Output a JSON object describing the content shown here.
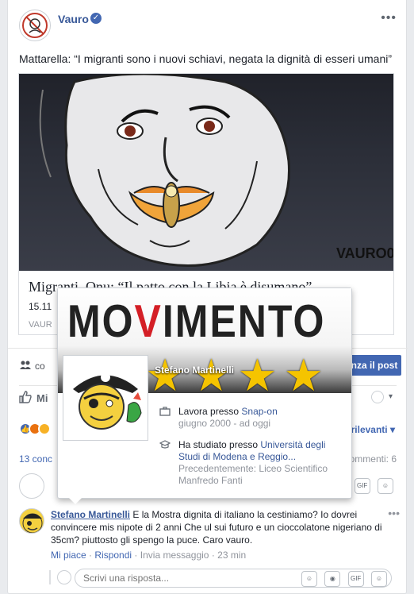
{
  "post": {
    "author": "Vauro",
    "verified_mark": "✓",
    "more_label": "•••",
    "text": "Mattarella: “I migranti sono i nuovi schiavi, negata la dignità di esseri umani”",
    "link": {
      "image_signature": "VAURO017",
      "title": "Migranti, Onu: “Il patto con la Libia è disumano”",
      "date": "15.11",
      "domain": "VAUR"
    }
  },
  "promo": {
    "text": "co",
    "button_label": "nza il post"
  },
  "actions": {
    "like_label": "Mi",
    "page_icon": "vauro-avatar-small",
    "caret": "▾"
  },
  "reactions": {
    "sort_label": "ù rilevanti ▾",
    "items": [
      "like",
      "angry",
      "wow"
    ]
  },
  "counts": {
    "left": "13 conc",
    "right": "Commenti: 6"
  },
  "compose": {
    "gif_label": "GIF",
    "sticker_label": "☺"
  },
  "comment": {
    "author": "Stefano Martinelli",
    "text": " E la Mostra dignita di italiano la cestiniamo? Io dovrei convincere mis nipote di 2 anni Che ul sui futuro e un cioccolatone nigeriano di 35cm? piuttosto gli spengo la puce. Caro vauro.",
    "like": "Mi piace",
    "reply": "Rispondi",
    "message": "Invia messaggio",
    "time": "23 min",
    "more": "•••"
  },
  "reply_box": {
    "placeholder": "Scrivi una risposta..."
  },
  "hovercard": {
    "cover_title_start": "MO",
    "cover_title_v": "V",
    "cover_title_end": "IMENTO",
    "stars": "★★★★",
    "name": "Stefano Martinelli",
    "work_prefix": "Lavora presso ",
    "work_link": "Snap-on",
    "work_period": "giugno 2000 - ad oggi",
    "study_prefix": "Ha studiato presso ",
    "study_link": "Università degli Studi di Modena e Reggio...",
    "previous": "Precedentemente: Liceo Scientifico Manfredo Fanti"
  },
  "colors": {
    "accent": "#4267b2",
    "link": "#385898",
    "movimento_red": "#d41f26",
    "star_yellow": "#f5c400"
  }
}
